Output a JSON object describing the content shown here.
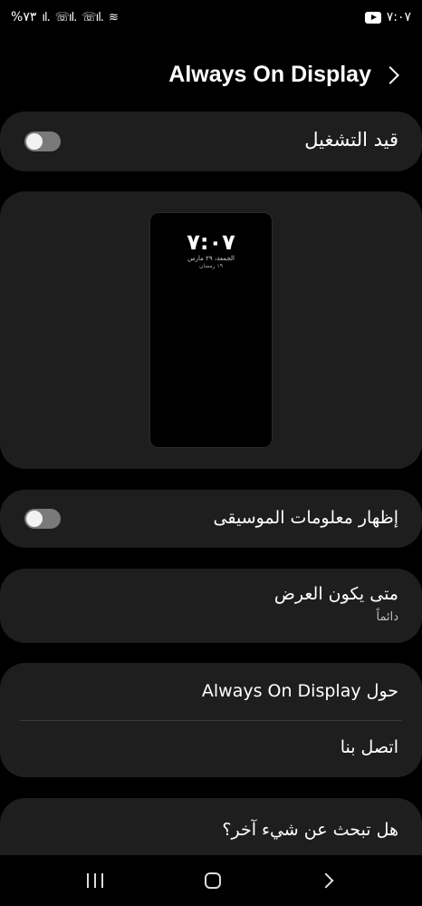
{
  "status_bar": {
    "battery": "%٧٣",
    "time": "٧:٠٧"
  },
  "header": {
    "title": "Always On Display"
  },
  "toggle_main": {
    "label": "قيد التشغيل",
    "enabled": false
  },
  "preview": {
    "time": "٧:٠٧",
    "date": "الجمعة، ٢٩ مارس",
    "hijri": "١٩ رمضان"
  },
  "music": {
    "label": "إظهار معلومات الموسيقى",
    "enabled": false
  },
  "when": {
    "label": "متى يكون العرض",
    "value": "دائماً"
  },
  "about": {
    "label": "حول Always On Display",
    "contact": "اتصل بنا"
  },
  "more": {
    "label": "هل تبحث عن شيء آخر؟"
  }
}
